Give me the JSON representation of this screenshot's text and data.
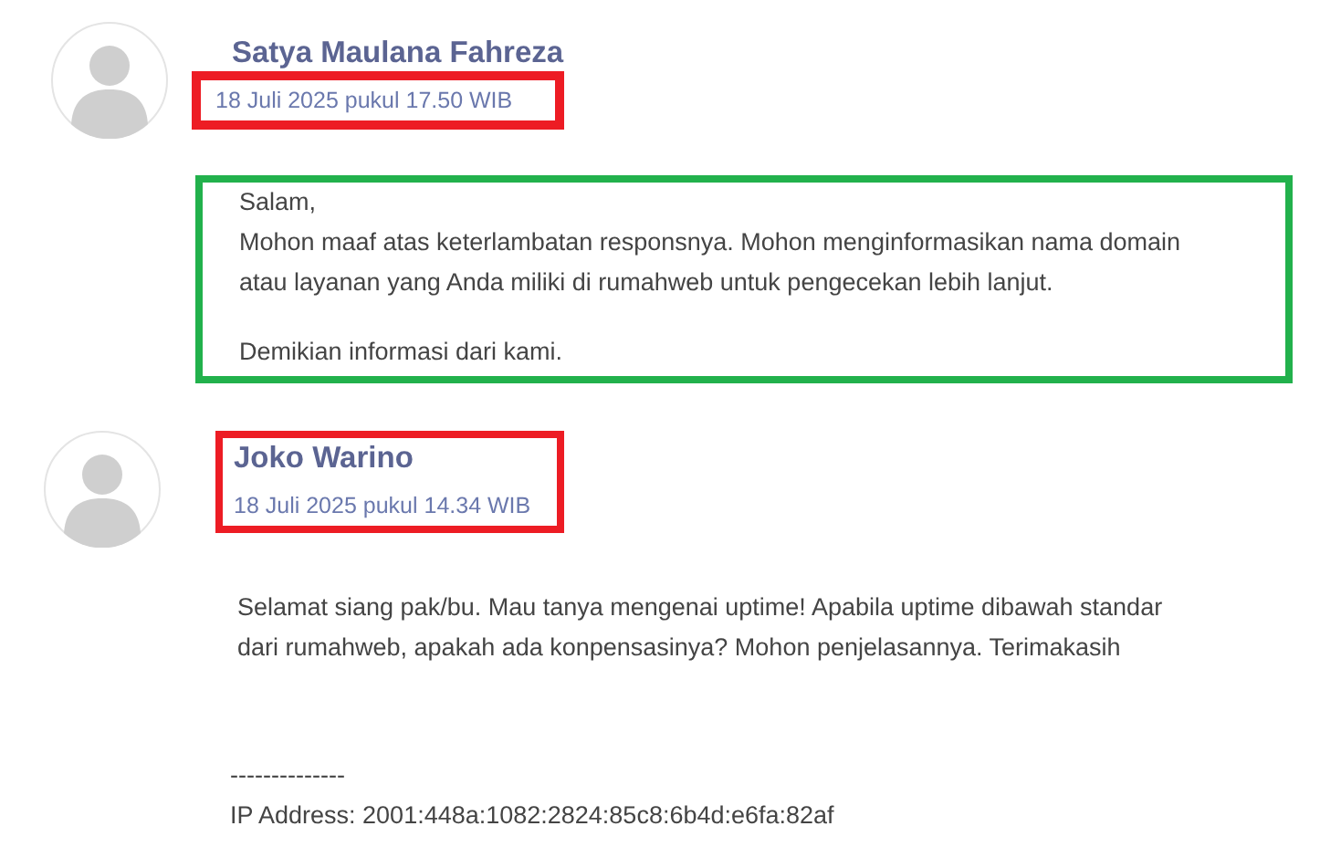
{
  "messages": [
    {
      "author": "Satya Maulana Fahreza",
      "date": "18 Juli 2025 pukul 17.50 WIB",
      "date_box": {
        "color": "#ed1c24"
      },
      "body_box": {
        "color": "#22b14c"
      },
      "paragraphs": [
        "Salam,\nMohon maaf atas keterlambatan responsnya. Mohon menginformasikan nama domain\natau layanan yang Anda miliki di rumahweb untuk pengecekan lebih lanjut.",
        "Demikian informasi dari kami."
      ]
    },
    {
      "author": "Joko Warino",
      "date": "18 Juli 2025 pukul 14.34 WIB",
      "header_box": {
        "color": "#ed1c24"
      },
      "paragraphs": [
        "Selamat siang pak/bu. Mau tanya mengenai uptime! Apabila uptime dibawah standar\ndari rumahweb, apakah ada konpensasinya? Mohon penjelasannya. Terimakasih"
      ],
      "signature": [
        "--------------",
        "IP Address: 2001:448a:1082:2824:85c8:6b4d:e6fa:82af"
      ]
    }
  ]
}
